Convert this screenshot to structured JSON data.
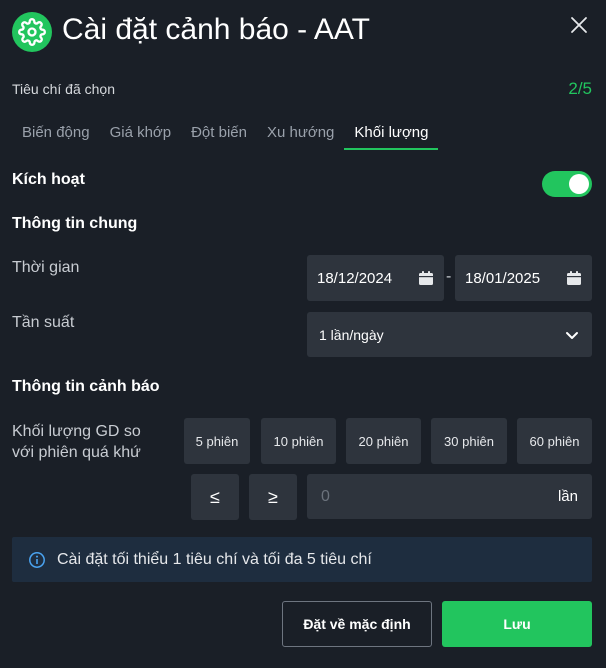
{
  "header": {
    "title": "Cài đặt cảnh báo - AAT"
  },
  "criteria": {
    "label": "Tiêu chí đã chọn",
    "count": "2/5"
  },
  "tabs": [
    {
      "label": "Biến động"
    },
    {
      "label": "Giá khớp"
    },
    {
      "label": "Đột biến"
    },
    {
      "label": "Xu hướng"
    },
    {
      "label": "Khối lượng"
    }
  ],
  "activation": {
    "label": "Kích hoạt",
    "enabled": true
  },
  "general": {
    "heading": "Thông tin chung",
    "time_label": "Thời gian",
    "date_from": "18/12/2024",
    "date_separator": "-",
    "date_to": "18/01/2025",
    "frequency_label": "Tần suất",
    "frequency_value": "1 lần/ngày"
  },
  "alert": {
    "heading": "Thông tin cảnh báo",
    "volume_label_line1": "Khối lượng GD so",
    "volume_label_line2": "với phiên quá khứ",
    "sessions": [
      "5 phiên",
      "10 phiên",
      "20 phiên",
      "30 phiên",
      "60 phiên"
    ],
    "lte": "≤",
    "gte": "≥",
    "value_placeholder": "0",
    "unit": "lần"
  },
  "info": {
    "text": "Cài đặt tối thiểu 1 tiêu chí và tối đa 5 tiêu chí"
  },
  "buttons": {
    "reset": "Đặt về mặc định",
    "save": "Lưu"
  },
  "colors": {
    "accent": "#22c55e",
    "background": "#1a1f27",
    "field": "#2e343d",
    "info_bg": "#1e2d3f"
  }
}
